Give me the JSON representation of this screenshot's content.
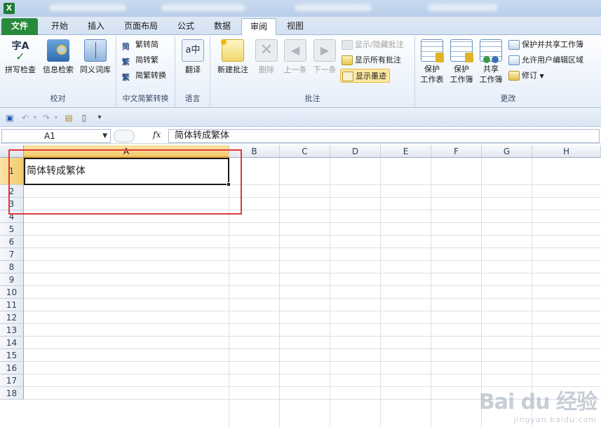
{
  "ribbon_tabs": [
    "文件",
    "开始",
    "插入",
    "页面布局",
    "公式",
    "数据",
    "审阅",
    "视图"
  ],
  "active_tab": "审阅",
  "groups": {
    "proofing": {
      "label": "校对",
      "buttons": [
        "拼写检查",
        "信息检索",
        "同义词库"
      ]
    },
    "chinese": {
      "label": "中文简繁转换",
      "buttons": [
        "繁转简",
        "简转繁",
        "简繁转换"
      ]
    },
    "language": {
      "label": "语言",
      "buttons": [
        "翻译"
      ]
    },
    "comments": {
      "label": "批注",
      "big": [
        "新建批注",
        "删除",
        "上一条",
        "下一条"
      ],
      "small": [
        "显示/隐藏批注",
        "显示所有批注",
        "显示墨迹"
      ]
    },
    "changes": {
      "label": "更改",
      "big": [
        "保护\n工作表",
        "保护\n工作簿",
        "共享\n工作簿"
      ],
      "small": [
        "保护并共享工作簿",
        "允许用户编辑区域",
        "修订"
      ]
    }
  },
  "formula_bar": {
    "name_box": "A1",
    "fx": "fx",
    "content": "简体转成繁体"
  },
  "columns": [
    "A",
    "B",
    "C",
    "D",
    "E",
    "F",
    "G",
    "H"
  ],
  "rows": [
    "1",
    "2",
    "3",
    "4",
    "5",
    "6",
    "7",
    "8",
    "9",
    "10",
    "11",
    "12",
    "13",
    "14",
    "15",
    "16",
    "17",
    "18"
  ],
  "cell_a1": "简体转成繁体",
  "watermark": {
    "brand": "Bai du 经验",
    "url": "jingyan.baidu.com"
  }
}
